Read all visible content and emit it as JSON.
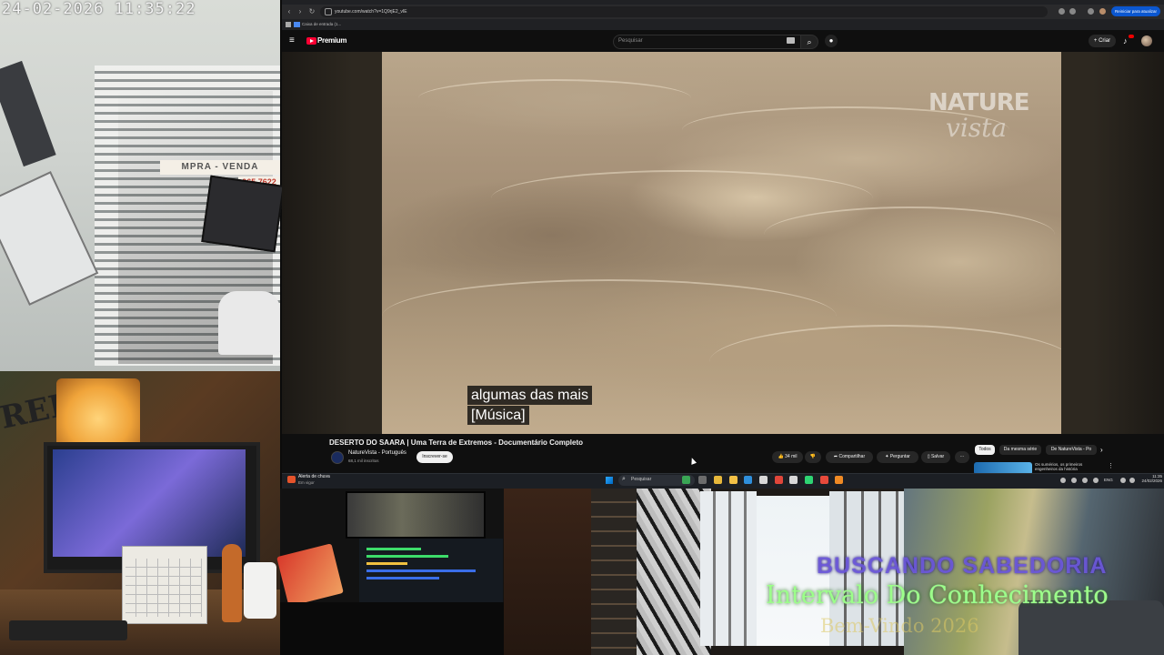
{
  "camera": {
    "timestamp": "24-02-2026  11:35:22",
    "store_sign": "MPRA - VENDA",
    "store_phone": "965 7622"
  },
  "room": {
    "graffiti_text": "REP"
  },
  "browser": {
    "url": "youtube.com/watch?v=1Q9rjE2_vIE",
    "update_button": "Reiniciar para atualizar",
    "bookmark": "Caixa de entrada (1..."
  },
  "youtube": {
    "brand": "Premium",
    "search_placeholder": "Pesquisar",
    "create_label": "+ Criar",
    "video": {
      "watermark_line1": "NATURE",
      "watermark_line2": "vista",
      "captions": [
        "algumas das mais",
        "[Música]"
      ],
      "title": "DESERTO DO SAARA | Uma Terra de Extremos - Documentário Completo"
    },
    "channel": {
      "name": "NatureVista - Português",
      "subscribers": "68,1 mil inscritos",
      "subscribe_label": "Inscrever-se"
    },
    "actions": {
      "like": "34 mil",
      "share": "Compartilhar",
      "ask": "Perguntar",
      "save": "Salvar",
      "more": "···"
    },
    "chips": [
      "Todos",
      "Da mesma série",
      "De NatureVista - Po"
    ],
    "recommendation": {
      "title": "Os sumérios, os primeiros engenheiros da história"
    }
  },
  "taskbar": {
    "weather_title": "Alerta de chuva",
    "weather_sub": "Em vigor",
    "search_label": "Pesquisar",
    "ime": "ENG",
    "time": "11:35",
    "date": "24/02/2026"
  },
  "overlay": {
    "line1": "BUSCANDO SABEDORIA",
    "line2": "Intervalo Do Conhecimento",
    "line3": "Bem-Vindo 2026"
  },
  "colors": {
    "youtube_red": "#ff0033",
    "overlay_green": "#9cff8a",
    "overlay_purple": "#6e5adc"
  }
}
